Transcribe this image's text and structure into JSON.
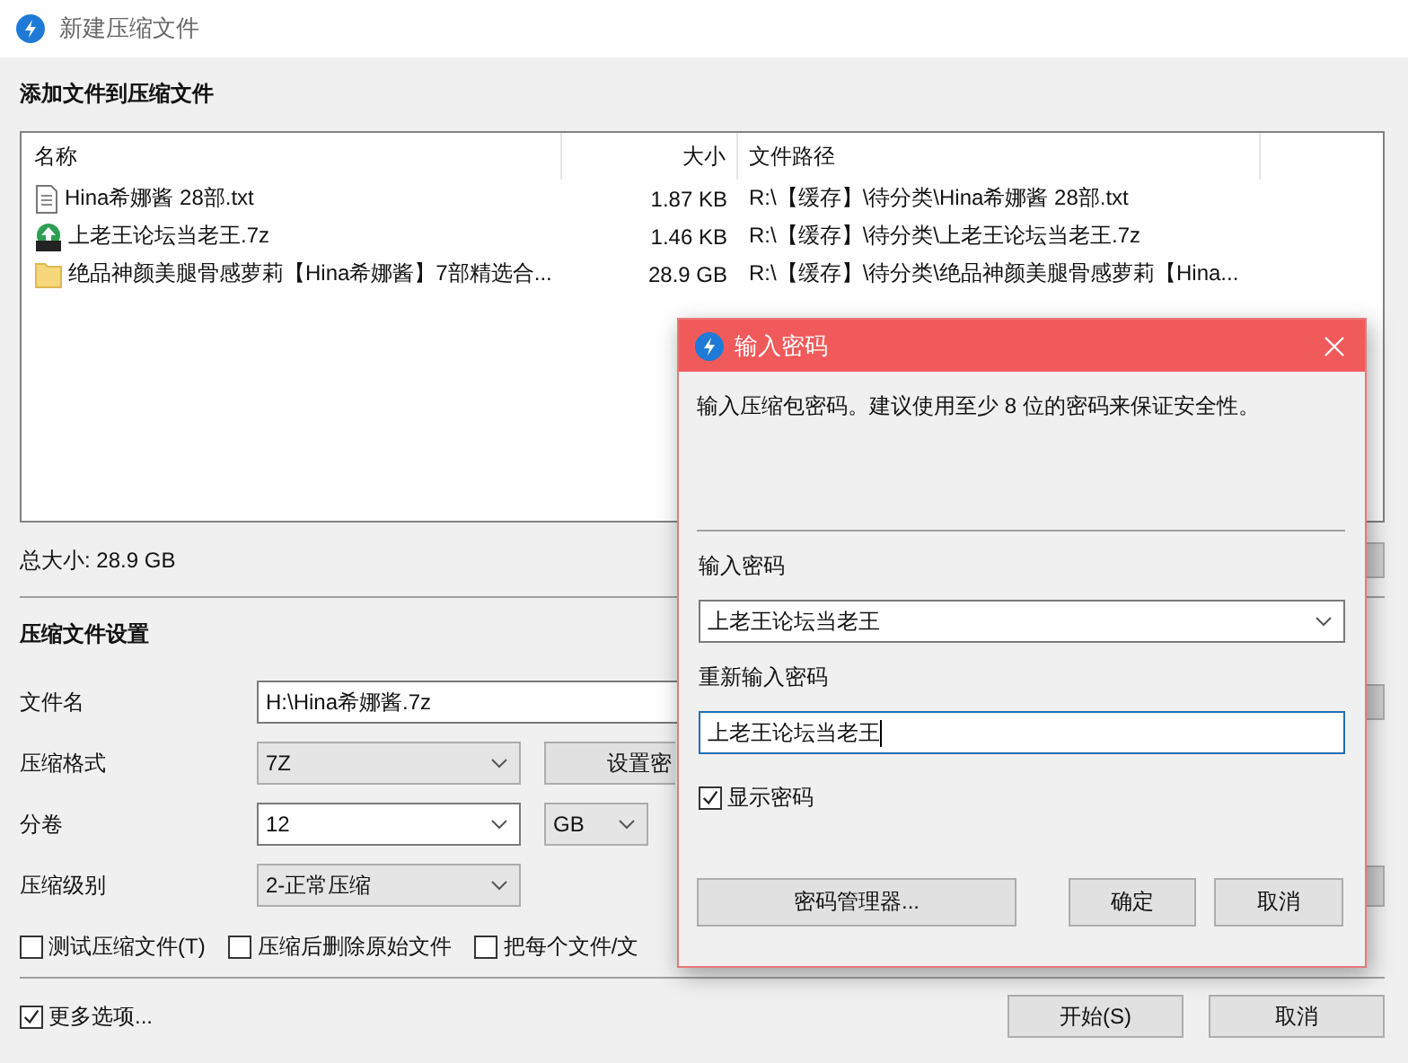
{
  "window": {
    "title": "新建压缩文件"
  },
  "files": {
    "heading": "添加文件到压缩文件",
    "columns": [
      "名称",
      "大小",
      "文件路径"
    ],
    "rows": [
      {
        "kind": "text",
        "name": "Hina希娜酱 28部.txt",
        "size": "1.87 KB",
        "path": "R:\\【缓存】\\待分类\\Hina希娜酱 28部.txt"
      },
      {
        "kind": "archive",
        "name": "上老王论坛当老王.7z",
        "size": "1.46 KB",
        "path": "R:\\【缓存】\\待分类\\上老王论坛当老王.7z"
      },
      {
        "kind": "folder",
        "name": "绝品神颜美腿骨感萝莉【Hina希娜酱】7部精选合...",
        "size": "28.9 GB",
        "path": "R:\\【缓存】\\待分类\\绝品神颜美腿骨感萝莉【Hina..."
      }
    ],
    "total": "总大小: 28.9 GB"
  },
  "settings": {
    "heading": "压缩文件设置",
    "fields": [
      {
        "kind": "text",
        "label": "文件名",
        "value": "H:\\Hina希娜酱.7z"
      },
      {
        "kind": "select",
        "label": "压缩格式",
        "value": "7Z",
        "button": "设置密"
      },
      {
        "kind": "combo",
        "label": "分卷",
        "value": "12",
        "unit": "GB"
      },
      {
        "kind": "select",
        "label": "压缩级别",
        "value": "2-正常压缩"
      }
    ],
    "options": [
      {
        "label": "测试压缩文件(T)",
        "checked": false
      },
      {
        "label": "压缩后删除原始文件",
        "checked": false
      },
      {
        "label": "把每个文件/文",
        "checked": false
      }
    ]
  },
  "more_options": {
    "label": "更多选项...",
    "checked": true
  },
  "buttons": [
    "开始(S)",
    "取消"
  ],
  "dialog": {
    "title": "输入密码",
    "message": "输入压缩包密码。建议使用至少 8 位的密码来保证安全性。",
    "password_label": "输入密码",
    "password": "上老王论坛当老王",
    "confirm_label": "重新输入密码",
    "confirm": "上老王论坛当老王",
    "show_password": {
      "label": "显示密码",
      "checked": true
    },
    "buttons": [
      "密码管理器...",
      "确定",
      "取消"
    ]
  }
}
